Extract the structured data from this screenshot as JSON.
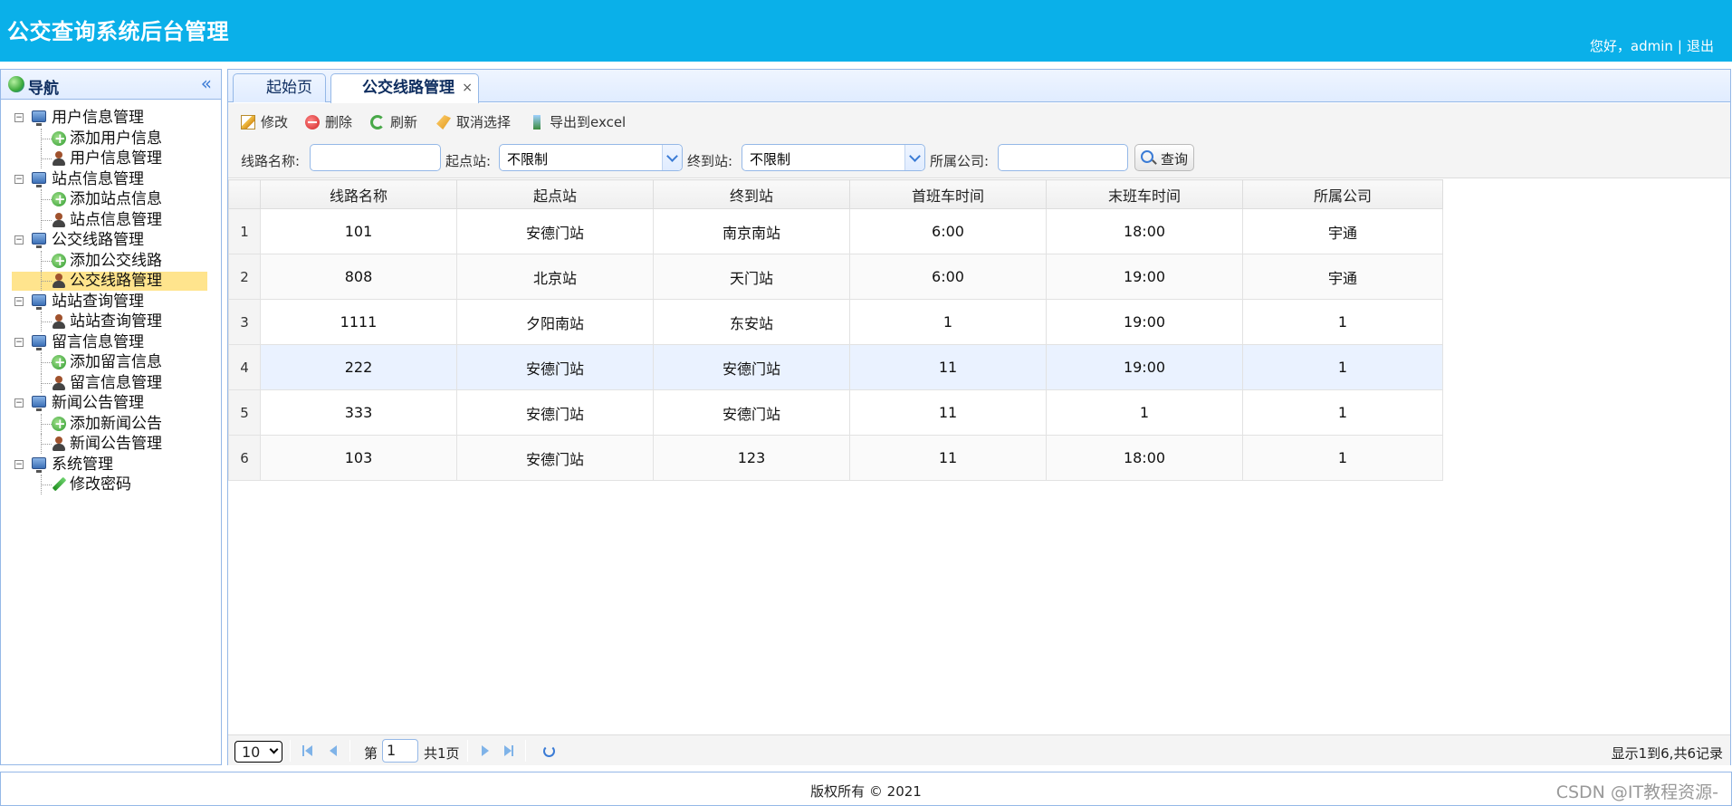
{
  "header": {
    "title": "公交查询系统后台管理",
    "greeting": "您好，admin",
    "separator": "|",
    "logout": "退出"
  },
  "sidebar": {
    "title": "导航",
    "groups": [
      {
        "label": "用户信息管理",
        "items": [
          {
            "label": "添加用户信息",
            "icon": "add-icon"
          },
          {
            "label": "用户信息管理",
            "icon": "user-icon"
          }
        ]
      },
      {
        "label": "站点信息管理",
        "items": [
          {
            "label": "添加站点信息",
            "icon": "add-icon"
          },
          {
            "label": "站点信息管理",
            "icon": "user-icon"
          }
        ]
      },
      {
        "label": "公交线路管理",
        "items": [
          {
            "label": "添加公交线路",
            "icon": "add-icon"
          },
          {
            "label": "公交线路管理",
            "icon": "user-icon",
            "selected": true
          }
        ]
      },
      {
        "label": "站站查询管理",
        "items": [
          {
            "label": "站站查询管理",
            "icon": "user-icon"
          }
        ]
      },
      {
        "label": "留言信息管理",
        "items": [
          {
            "label": "添加留言信息",
            "icon": "add-icon"
          },
          {
            "label": "留言信息管理",
            "icon": "user-icon"
          }
        ]
      },
      {
        "label": "新闻公告管理",
        "items": [
          {
            "label": "添加新闻公告",
            "icon": "add-icon"
          },
          {
            "label": "新闻公告管理",
            "icon": "user-icon"
          }
        ]
      },
      {
        "label": "系统管理",
        "items": [
          {
            "label": "修改密码",
            "icon": "pencil-icon"
          }
        ]
      }
    ]
  },
  "tabs": {
    "home": "起始页",
    "active": "公交线路管理",
    "close": "×"
  },
  "toolbar": {
    "edit": "修改",
    "delete": "删除",
    "refresh": "刷新",
    "cancel_select": "取消选择",
    "export": "导出到excel"
  },
  "search": {
    "line_label": "线路名称:",
    "line_value": "",
    "start_label": "起点站:",
    "start_value": "不限制",
    "end_label": "终到站:",
    "end_value": "不限制",
    "company_label": "所属公司:",
    "company_value": "",
    "query_button": "查询"
  },
  "grid": {
    "columns": [
      "线路名称",
      "起点站",
      "终到站",
      "首班车时间",
      "末班车时间",
      "所属公司"
    ],
    "rows": [
      {
        "n": "1",
        "cells": [
          "101",
          "安德门站",
          "南京南站",
          "6:00",
          "18:00",
          "宇通"
        ]
      },
      {
        "n": "2",
        "cells": [
          "808",
          "北京站",
          "天门站",
          "6:00",
          "19:00",
          "宇通"
        ]
      },
      {
        "n": "3",
        "cells": [
          "1111",
          "夕阳南站",
          "东安站",
          "1",
          "19:00",
          "1"
        ]
      },
      {
        "n": "4",
        "cells": [
          "222",
          "安德门站",
          "安德门站",
          "11",
          "19:00",
          "1"
        ]
      },
      {
        "n": "5",
        "cells": [
          "333",
          "安德门站",
          "安德门站",
          "11",
          "1",
          "1"
        ]
      },
      {
        "n": "6",
        "cells": [
          "103",
          "安德门站",
          "123",
          "11",
          "18:00",
          "1"
        ]
      }
    ]
  },
  "pager": {
    "page_size": "10",
    "page_prefix": "第",
    "page_number": "1",
    "page_total": "共1页",
    "info": "显示1到6,共6记录"
  },
  "footer": {
    "copyright": "版权所有 © 2021",
    "watermark": "CSDN @IT教程资源-"
  },
  "colors": {
    "header_bg": "#0ab0e9",
    "border": "#95b8e7",
    "selected_tree": "#ffe48d"
  }
}
